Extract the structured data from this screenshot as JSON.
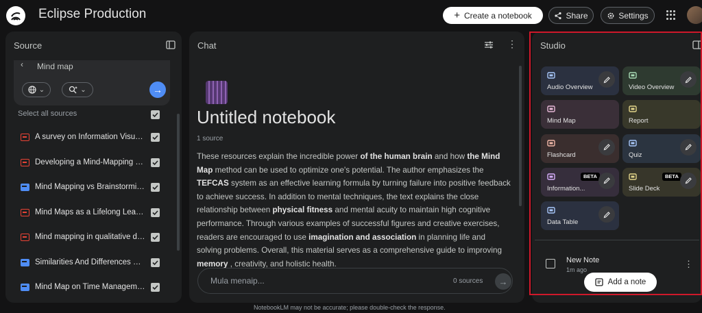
{
  "header": {
    "app_title": "Eclipse Production",
    "create_label": "Create a notebook",
    "share_label": "Share",
    "settings_label": "Settings"
  },
  "source": {
    "title": "Source",
    "search_query": "Mind map",
    "select_all_label": "Select all sources",
    "items": [
      {
        "label": "A survey on Information Visuali...",
        "type": "pdf"
      },
      {
        "label": "Developing a Mind-Mapping M...",
        "type": "pdf"
      },
      {
        "label": "Mind Mapping vs Brainstormin...",
        "type": "web"
      },
      {
        "label": "Mind Maps as a Lifelong Learni...",
        "type": "pdf"
      },
      {
        "label": "Mind mapping in qualitative da...",
        "type": "pdf"
      },
      {
        "label": "Similarities And Differences Be...",
        "type": "web"
      },
      {
        "label": "Mind Map on Time Manageme...",
        "type": "web"
      }
    ]
  },
  "chat": {
    "title": "Chat",
    "notebook_title": "Untitled notebook",
    "source_count": "1 source",
    "summary": [
      {
        "t": "These resources explain the incredible power "
      },
      {
        "t": "of the human brain",
        "b": true
      },
      {
        "t": " and how "
      },
      {
        "t": "the Mind Map",
        "b": true
      },
      {
        "t": " method can be used to optimize one's potential. The author emphasizes the "
      },
      {
        "t": "TEFCAS",
        "b": true
      },
      {
        "t": " system as an effective learning formula by turning failure into positive feedback to achieve success. In addition to mental techniques, the text explains the close relationship between "
      },
      {
        "t": "physical fitness",
        "b": true
      },
      {
        "t": " and mental acuity to maintain high cognitive performance. Through various examples of successful figures and creative exercises, readers are encouraged to use "
      },
      {
        "t": "imagination and association",
        "b": true
      },
      {
        "t": " in planning life and solving problems. Overall, this material serves as a comprehensive guide to improving "
      },
      {
        "t": "memory",
        "b": true
      },
      {
        "t": " , creativity, and holistic health."
      }
    ],
    "input_placeholder": "Mula menaip...",
    "input_sources": "0 sources"
  },
  "studio": {
    "title": "Studio",
    "tiles": [
      {
        "label": "Audio Overview",
        "color": "#2b3140",
        "icon_color": "#a8c7fa",
        "edit": true
      },
      {
        "label": "Video Overview",
        "color": "#2e3a30",
        "icon_color": "#a8dab5",
        "edit": true
      },
      {
        "label": "Mind Map",
        "color": "#3a2f38",
        "icon_color": "#e8b8d8",
        "edit": false
      },
      {
        "label": "Report",
        "color": "#38382a",
        "icon_color": "#e3d58a",
        "edit": false
      },
      {
        "label": "Flashcard",
        "color": "#3a2e2e",
        "icon_color": "#f2b8a8",
        "edit": true
      },
      {
        "label": "Quiz",
        "color": "#2b3440",
        "icon_color": "#a8c7fa",
        "edit": true
      },
      {
        "label": "Information...",
        "color": "#362e3c",
        "icon_color": "#d7aefb",
        "edit": true,
        "beta": "BETA"
      },
      {
        "label": "Slide Deck",
        "color": "#37362a",
        "icon_color": "#e3d58a",
        "edit": true,
        "beta": "BETA"
      },
      {
        "label": "Data Table",
        "color": "#2b3140",
        "icon_color": "#a8c7fa",
        "edit": true
      }
    ],
    "note": {
      "title": "New Note",
      "time": "1m ago"
    },
    "add_note_label": "Add a note"
  },
  "footer": "NotebookLM may not be accurate; please double-check the response."
}
